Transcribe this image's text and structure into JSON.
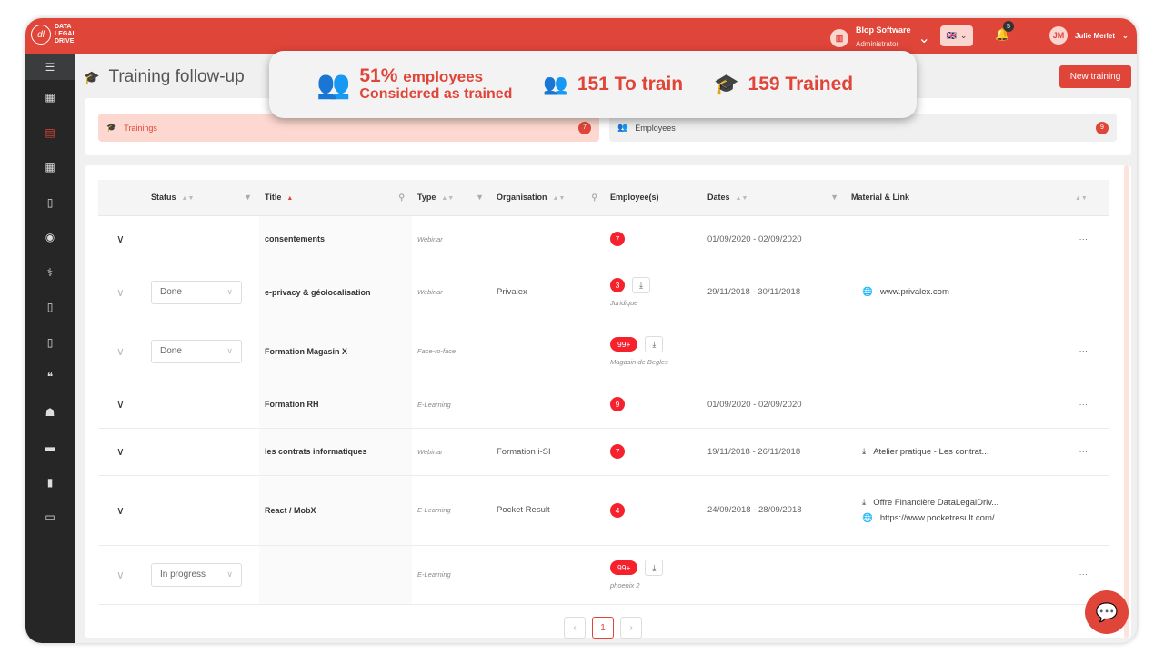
{
  "brand": {
    "logo_text": "DATA LEGAL DRIVE"
  },
  "header": {
    "company": "Blop Software",
    "role": "Administrator",
    "notifications": "5",
    "user_initials": "JM",
    "user_name": "Julie Merlet"
  },
  "page": {
    "title": "Training follow-up",
    "new_button": "New training"
  },
  "stats": {
    "percent": "51%",
    "percent_label": "employees",
    "percent_sub": "Considered as trained",
    "to_train": "151 To train",
    "trained": "159 Trained"
  },
  "tabs": [
    {
      "label": "Trainings",
      "count": "7",
      "active": true
    },
    {
      "label": "Employees",
      "count": "9",
      "active": false
    }
  ],
  "columns": [
    "Status",
    "Title",
    "Type",
    "Organisation",
    "Employee(s)",
    "Dates",
    "Material & Link"
  ],
  "rows": [
    {
      "expanded_style": "dark",
      "status": "",
      "title": "consentements",
      "type": "Webinar",
      "organisation": "",
      "employees": "7",
      "download": false,
      "group": "",
      "dates": "01/09/2020 - 02/09/2020",
      "links": []
    },
    {
      "expanded_style": "dim",
      "status": "Done",
      "title": "e-privacy & géolocalisation",
      "type": "Webinar",
      "organisation": "Privalex",
      "employees": "3",
      "download": true,
      "group": "Juridique",
      "dates": "29/11/2018 - 30/11/2018",
      "links": [
        {
          "icon": "globe-icon",
          "text": "www.privalex.com"
        }
      ]
    },
    {
      "expanded_style": "dim",
      "status": "Done",
      "title": "Formation Magasin X",
      "type": "Face-to-face",
      "organisation": "",
      "employees": "99+",
      "download": true,
      "group": "Magasin de Begles",
      "dates": "",
      "links": []
    },
    {
      "expanded_style": "dark",
      "status": "",
      "title": "Formation RH",
      "type": "E-Learning",
      "organisation": "",
      "employees": "9",
      "download": false,
      "group": "",
      "dates": "01/09/2020 - 02/09/2020",
      "links": []
    },
    {
      "expanded_style": "dark",
      "status": "",
      "title": "les contrats informatiques",
      "type": "Webinar",
      "organisation": "Formation i-SI",
      "employees": "7",
      "download": false,
      "group": "",
      "dates": "19/11/2018 - 26/11/2018",
      "links": [
        {
          "icon": "download-icon",
          "text": "Atelier pratique - Les contrat..."
        }
      ]
    },
    {
      "expanded_style": "dark",
      "status": "",
      "title": "React / MobX",
      "type": "E-Learning",
      "organisation": "Pocket Result",
      "employees": "4",
      "download": false,
      "group": "",
      "dates": "24/09/2018 - 28/09/2018",
      "links": [
        {
          "icon": "download-icon",
          "text": "Offre Financière DataLegalDriv..."
        },
        {
          "icon": "globe-icon",
          "text": "https://www.pocketresult.com/"
        }
      ]
    },
    {
      "expanded_style": "dim",
      "status": "In progress",
      "title": "",
      "type": "E-Learning",
      "organisation": "",
      "employees": "99+",
      "download": true,
      "group": "phoenix 2",
      "dates": "",
      "links": []
    }
  ],
  "pagination": {
    "current": "1"
  },
  "colors": {
    "brand": "#e04539",
    "badge": "#f5222d",
    "sidebar": "#262626"
  }
}
